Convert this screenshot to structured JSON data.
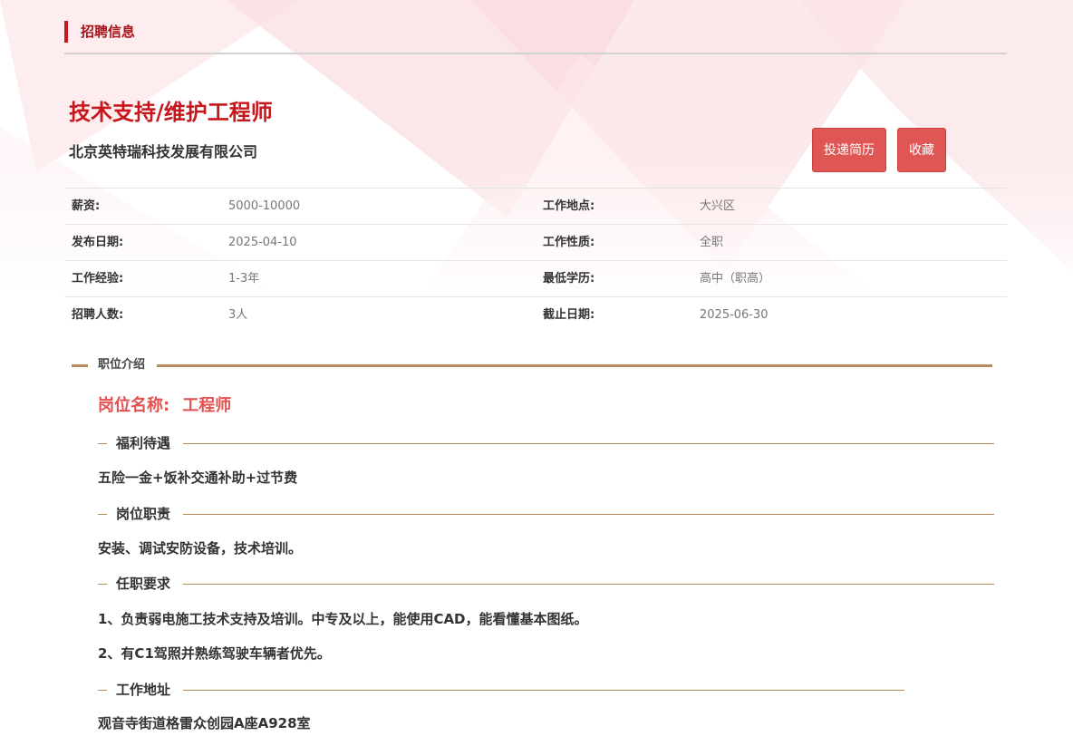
{
  "section": {
    "title": "招聘信息"
  },
  "job": {
    "title": "技术支持/维护工程师",
    "company": "北京英特瑞科技发展有限公司"
  },
  "actions": {
    "apply_label": "投递简历",
    "favorite_label": "收藏"
  },
  "info": {
    "rows": [
      {
        "l1": "薪资:",
        "v1": "5000-10000",
        "l2": "工作地点:",
        "v2": "大兴区"
      },
      {
        "l1": "发布日期:",
        "v1": "2025-04-10",
        "l2": "工作性质:",
        "v2": "全职"
      },
      {
        "l1": "工作经验:",
        "v1": "1-3年",
        "l2": "最低学历:",
        "v2": "高中（职高）"
      },
      {
        "l1": "招聘人数:",
        "v1": "3人",
        "l2": "截止日期:",
        "v2": "2025-06-30"
      }
    ]
  },
  "intro": {
    "heading": "职位介绍",
    "position_label": "岗位名称:",
    "position_value": "工程师",
    "benefits_heading": "福利待遇",
    "benefits_text": "五险一金+饭补交通补助+过节费",
    "duties_heading": "岗位职责",
    "duties_text": "安装、调试安防设备，技术培训。",
    "requirements_heading": "任职要求",
    "requirements": [
      "1、负责弱电施工技术支持及培训。中专及以上，能使用CAD，能看懂基本图纸。",
      "2、有C1驾照并熟练驾驶车辆者优先。"
    ],
    "address_heading": "工作地址",
    "address_text": "观音寺街道格雷众创园A座A928室"
  },
  "colors": {
    "brand_red": "#c8161d",
    "button_red": "#de5754",
    "accent_gold": "#b48a5e",
    "position_red": "#e35050"
  }
}
